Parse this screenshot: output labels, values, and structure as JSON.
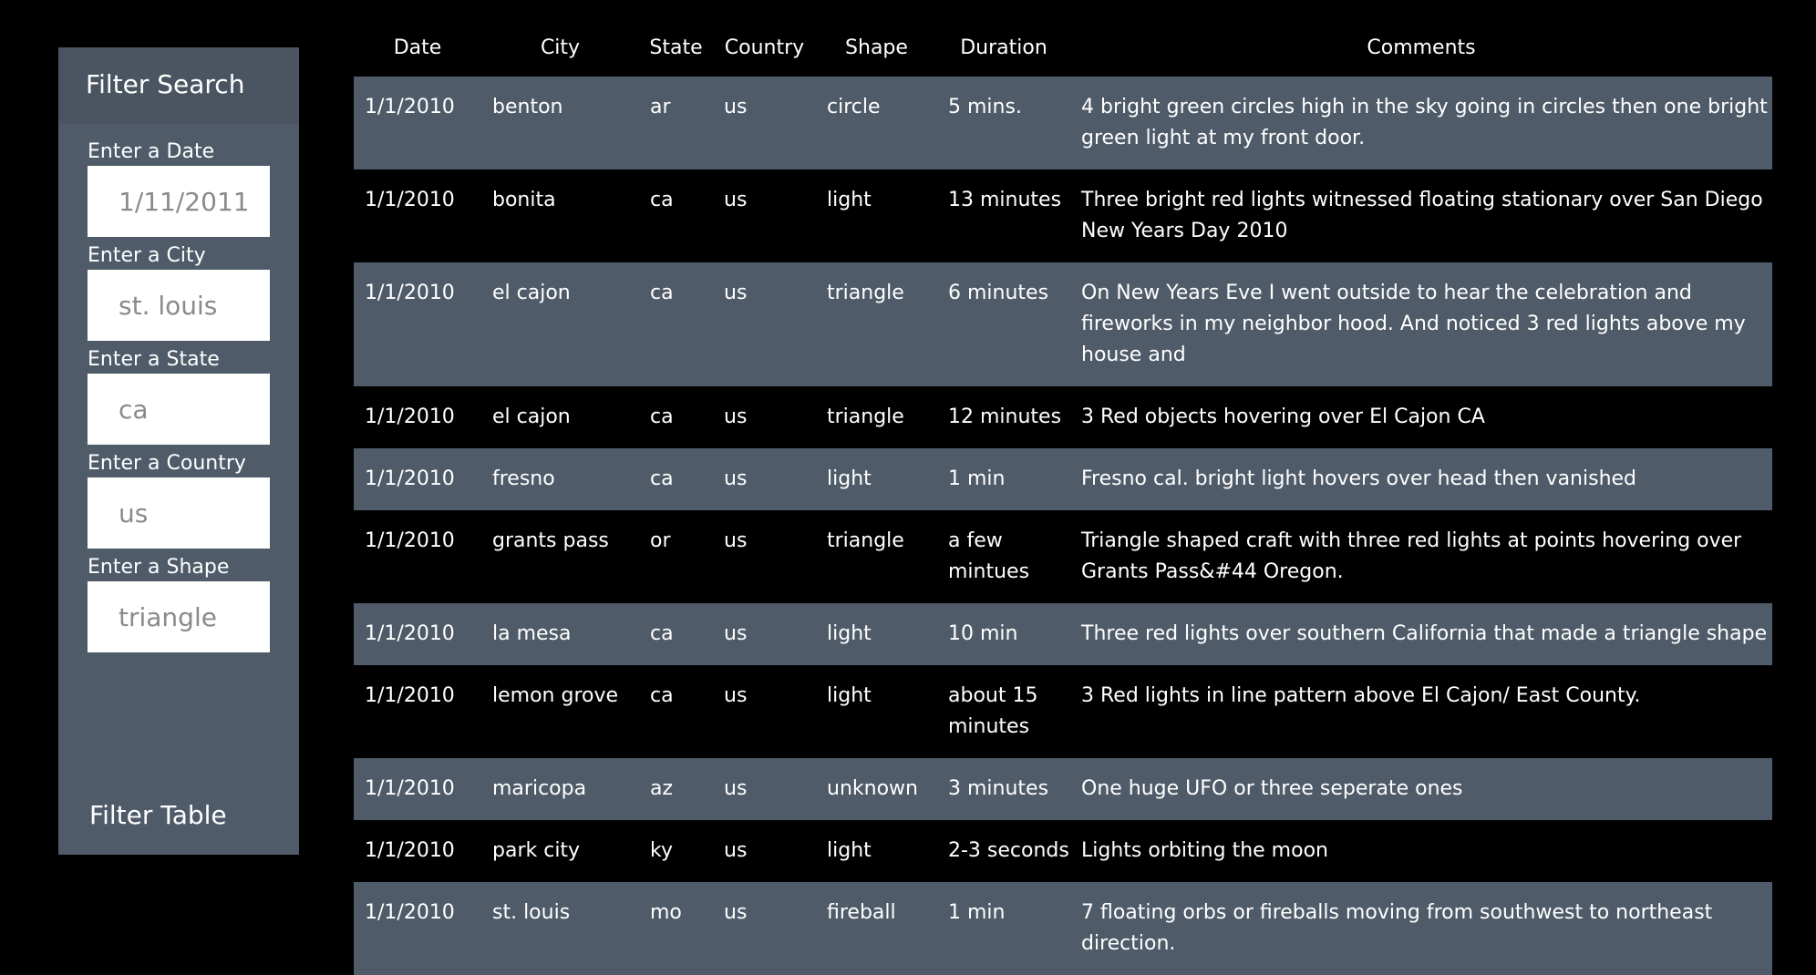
{
  "sidebar": {
    "title": "Filter Search",
    "fields": [
      {
        "label": "Enter a Date",
        "placeholder": "1/11/2011"
      },
      {
        "label": "Enter a City",
        "placeholder": "st. louis"
      },
      {
        "label": "Enter a State",
        "placeholder": "ca"
      },
      {
        "label": "Enter a Country",
        "placeholder": "us"
      },
      {
        "label": "Enter a Shape",
        "placeholder": "triangle"
      }
    ],
    "filter_button": "Filter Table"
  },
  "table": {
    "headers": [
      "Date",
      "City",
      "State",
      "Country",
      "Shape",
      "Duration",
      "Comments"
    ],
    "rows": [
      [
        "1/1/2010",
        "benton",
        "ar",
        "us",
        "circle",
        "5 mins.",
        "4 bright green circles high in the sky going in circles then one bright green light at my front door."
      ],
      [
        "1/1/2010",
        "bonita",
        "ca",
        "us",
        "light",
        "13 minutes",
        "Three bright red lights witnessed floating stationary over San Diego New Years Day 2010"
      ],
      [
        "1/1/2010",
        "el cajon",
        "ca",
        "us",
        "triangle",
        "6 minutes",
        "On New Years Eve I went outside to hear the celebration and fireworks in my neighbor hood. And noticed 3 red lights above my house and"
      ],
      [
        "1/1/2010",
        "el cajon",
        "ca",
        "us",
        "triangle",
        "12 minutes",
        "3 Red objects hovering over El Cajon CA"
      ],
      [
        "1/1/2010",
        "fresno",
        "ca",
        "us",
        "light",
        "1 min",
        "Fresno cal. bright light hovers over head then vanished"
      ],
      [
        "1/1/2010",
        "grants pass",
        "or",
        "us",
        "triangle",
        "a few mintues",
        "Triangle shaped craft with three red lights at points hovering over Grants Pass&#44 Oregon."
      ],
      [
        "1/1/2010",
        "la mesa",
        "ca",
        "us",
        "light",
        "10 min",
        "Three red lights over southern California that made a triangle shape"
      ],
      [
        "1/1/2010",
        "lemon grove",
        "ca",
        "us",
        "light",
        "about 15 minutes",
        "3 Red lights in line pattern above El Cajon/ East County."
      ],
      [
        "1/1/2010",
        "maricopa",
        "az",
        "us",
        "unknown",
        "3 minutes",
        "One huge UFO or three seperate ones"
      ],
      [
        "1/1/2010",
        "park city",
        "ky",
        "us",
        "light",
        "2-3 seconds",
        "Lights orbiting the moon"
      ],
      [
        "1/1/2010",
        "st. louis",
        "mo",
        "us",
        "fireball",
        "1 min",
        "7 floating orbs or fireballs moving from southwest to northeast direction."
      ]
    ]
  }
}
